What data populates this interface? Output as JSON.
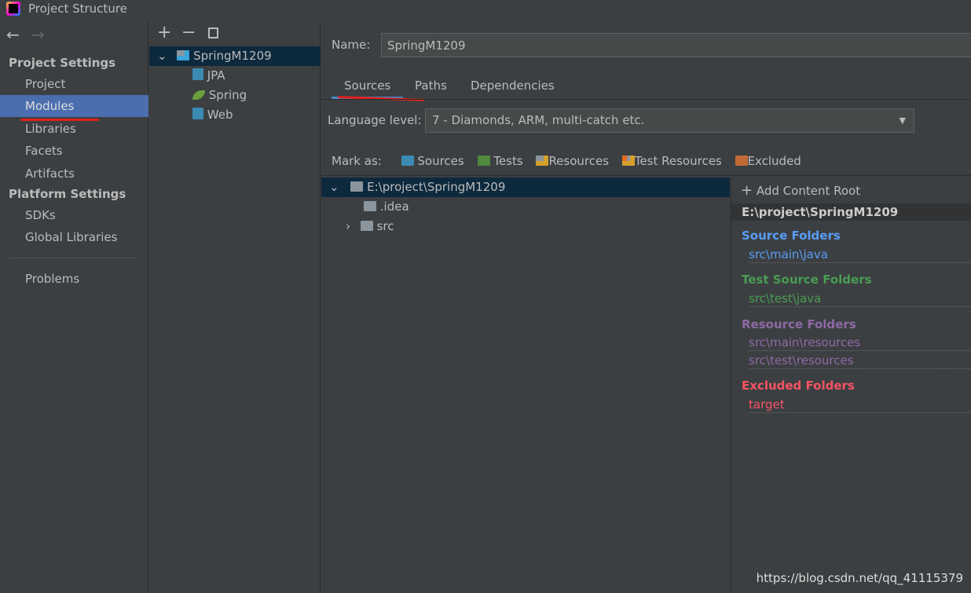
{
  "window": {
    "title": "Project Structure"
  },
  "sidebar": {
    "project_settings": "Project Settings",
    "items": [
      "Project",
      "Modules",
      "Libraries",
      "Facets",
      "Artifacts"
    ],
    "platform_settings": "Platform Settings",
    "platform_items": [
      "SDKs",
      "Global Libraries"
    ],
    "problems": "Problems",
    "selected": "Modules"
  },
  "modules_tree": {
    "toolbar": {
      "add": "+",
      "remove": "−",
      "copy": "copy"
    },
    "root": "SpringM1209",
    "children": [
      "JPA",
      "Spring",
      "Web"
    ]
  },
  "main": {
    "name_label": "Name:",
    "name_value": "SpringM1209",
    "tabs": [
      "Sources",
      "Paths",
      "Dependencies"
    ],
    "active_tab": "Sources",
    "language_label": "Language level:",
    "language_value": "7 - Diamonds, ARM, multi-catch etc.",
    "mark_as_label": "Mark as:",
    "mark_as": [
      {
        "label": "Sources",
        "color": "#3b8bb3"
      },
      {
        "label": "Tests",
        "color": "#4f8a3e"
      },
      {
        "label": "Resources",
        "color": "#8b959e"
      },
      {
        "label": "Test Resources",
        "color": "#8b959e"
      },
      {
        "label": "Excluded",
        "color": "#c16a36"
      }
    ],
    "file_tree": {
      "root": "E:\\project\\SpringM1209",
      "children": [
        ".idea",
        "src"
      ]
    }
  },
  "content_root": {
    "add_label": "Add Content Root",
    "path": "E:\\project\\SpringM1209",
    "source_folders": {
      "title": "Source Folders",
      "color": "#589df6",
      "items": [
        "src\\main\\java"
      ]
    },
    "test_source_folders": {
      "title": "Test Source Folders",
      "color": "#499c54",
      "items": [
        "src\\test\\java"
      ]
    },
    "resource_folders": {
      "title": "Resource Folders",
      "color": "#8e6aa6",
      "items": [
        "src\\main\\resources",
        "src\\test\\resources"
      ]
    },
    "excluded_folders": {
      "title": "Excluded Folders",
      "color": "#f75464",
      "items": [
        "target"
      ]
    }
  },
  "watermark": "https://blog.csdn.net/qq_41115379"
}
